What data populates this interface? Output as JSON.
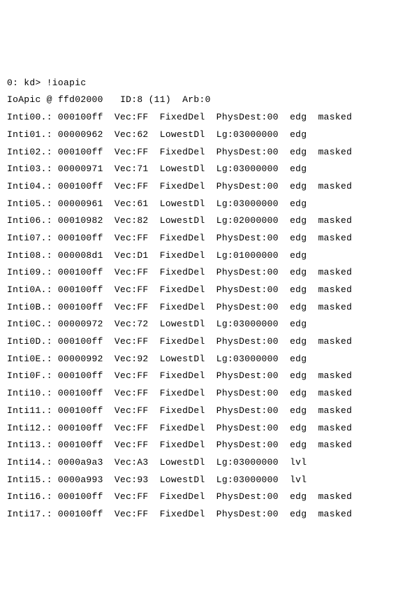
{
  "prompt": "0: kd> !ioapic",
  "header": {
    "label": "IoApic",
    "at": "@",
    "addr": "ffd02000",
    "id_label": "ID:8 (11)",
    "arb_label": "Arb:0"
  },
  "rows": [
    {
      "name": "Inti00.:",
      "raw": "000100ff",
      "vec": "Vec:FF",
      "del": "FixedDel",
      "dest": "PhysDest:00",
      "trig": "edg",
      "mask": "masked"
    },
    {
      "name": "Inti01.:",
      "raw": "00000962",
      "vec": "Vec:62",
      "del": "LowestDl",
      "dest": "Lg:03000000",
      "trig": "edg",
      "mask": ""
    },
    {
      "name": "Inti02.:",
      "raw": "000100ff",
      "vec": "Vec:FF",
      "del": "FixedDel",
      "dest": "PhysDest:00",
      "trig": "edg",
      "mask": "masked"
    },
    {
      "name": "Inti03.:",
      "raw": "00000971",
      "vec": "Vec:71",
      "del": "LowestDl",
      "dest": "Lg:03000000",
      "trig": "edg",
      "mask": ""
    },
    {
      "name": "Inti04.:",
      "raw": "000100ff",
      "vec": "Vec:FF",
      "del": "FixedDel",
      "dest": "PhysDest:00",
      "trig": "edg",
      "mask": "masked"
    },
    {
      "name": "Inti05.:",
      "raw": "00000961",
      "vec": "Vec:61",
      "del": "LowestDl",
      "dest": "Lg:03000000",
      "trig": "edg",
      "mask": ""
    },
    {
      "name": "Inti06.:",
      "raw": "00010982",
      "vec": "Vec:82",
      "del": "LowestDl",
      "dest": "Lg:02000000",
      "trig": "edg",
      "mask": "masked"
    },
    {
      "name": "Inti07.:",
      "raw": "000100ff",
      "vec": "Vec:FF",
      "del": "FixedDel",
      "dest": "PhysDest:00",
      "trig": "edg",
      "mask": "masked"
    },
    {
      "name": "Inti08.:",
      "raw": "000008d1",
      "vec": "Vec:D1",
      "del": "FixedDel",
      "dest": "Lg:01000000",
      "trig": "edg",
      "mask": ""
    },
    {
      "name": "Inti09.:",
      "raw": "000100ff",
      "vec": "Vec:FF",
      "del": "FixedDel",
      "dest": "PhysDest:00",
      "trig": "edg",
      "mask": "masked"
    },
    {
      "name": "Inti0A.:",
      "raw": "000100ff",
      "vec": "Vec:FF",
      "del": "FixedDel",
      "dest": "PhysDest:00",
      "trig": "edg",
      "mask": "masked"
    },
    {
      "name": "Inti0B.:",
      "raw": "000100ff",
      "vec": "Vec:FF",
      "del": "FixedDel",
      "dest": "PhysDest:00",
      "trig": "edg",
      "mask": "masked"
    },
    {
      "name": "Inti0C.:",
      "raw": "00000972",
      "vec": "Vec:72",
      "del": "LowestDl",
      "dest": "Lg:03000000",
      "trig": "edg",
      "mask": ""
    },
    {
      "name": "Inti0D.:",
      "raw": "000100ff",
      "vec": "Vec:FF",
      "del": "FixedDel",
      "dest": "PhysDest:00",
      "trig": "edg",
      "mask": "masked"
    },
    {
      "name": "Inti0E.:",
      "raw": "00000992",
      "vec": "Vec:92",
      "del": "LowestDl",
      "dest": "Lg:03000000",
      "trig": "edg",
      "mask": ""
    },
    {
      "name": "Inti0F.:",
      "raw": "000100ff",
      "vec": "Vec:FF",
      "del": "FixedDel",
      "dest": "PhysDest:00",
      "trig": "edg",
      "mask": "masked"
    },
    {
      "name": "Inti10.:",
      "raw": "000100ff",
      "vec": "Vec:FF",
      "del": "FixedDel",
      "dest": "PhysDest:00",
      "trig": "edg",
      "mask": "masked"
    },
    {
      "name": "Inti11.:",
      "raw": "000100ff",
      "vec": "Vec:FF",
      "del": "FixedDel",
      "dest": "PhysDest:00",
      "trig": "edg",
      "mask": "masked"
    },
    {
      "name": "Inti12.:",
      "raw": "000100ff",
      "vec": "Vec:FF",
      "del": "FixedDel",
      "dest": "PhysDest:00",
      "trig": "edg",
      "mask": "masked"
    },
    {
      "name": "Inti13.:",
      "raw": "000100ff",
      "vec": "Vec:FF",
      "del": "FixedDel",
      "dest": "PhysDest:00",
      "trig": "edg",
      "mask": "masked"
    },
    {
      "name": "Inti14.:",
      "raw": "0000a9a3",
      "vec": "Vec:A3",
      "del": "LowestDl",
      "dest": "Lg:03000000",
      "trig": "lvl",
      "mask": ""
    },
    {
      "name": "Inti15.:",
      "raw": "0000a993",
      "vec": "Vec:93",
      "del": "LowestDl",
      "dest": "Lg:03000000",
      "trig": "lvl",
      "mask": ""
    },
    {
      "name": "Inti16.:",
      "raw": "000100ff",
      "vec": "Vec:FF",
      "del": "FixedDel",
      "dest": "PhysDest:00",
      "trig": "edg",
      "mask": "masked"
    },
    {
      "name": "Inti17.:",
      "raw": "000100ff",
      "vec": "Vec:FF",
      "del": "FixedDel",
      "dest": "PhysDest:00",
      "trig": "edg",
      "mask": "masked"
    }
  ]
}
